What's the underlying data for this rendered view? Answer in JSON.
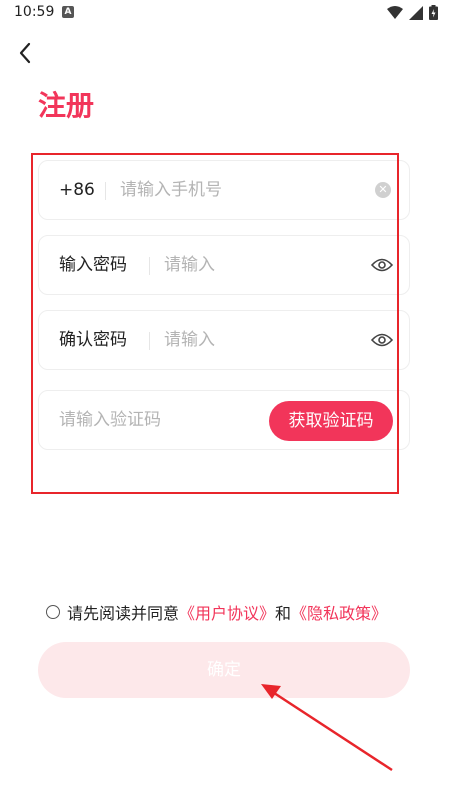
{
  "status_bar": {
    "time": "10:59",
    "notification_letter": "A"
  },
  "header": {
    "title": "注册"
  },
  "form": {
    "phone": {
      "prefix": "+86",
      "placeholder": "请输入手机号"
    },
    "password": {
      "label": "输入密码",
      "placeholder": "请输入"
    },
    "confirm_password": {
      "label": "确认密码",
      "placeholder": "请输入"
    },
    "verification": {
      "placeholder": "请输入验证码",
      "button_label": "获取验证码"
    }
  },
  "agreement": {
    "prefix": "请先阅读并同意",
    "user_agreement": "《用户协议》",
    "conjunction": "和",
    "privacy_policy": "《隐私政策》"
  },
  "confirm_button": {
    "label": "确定"
  },
  "colors": {
    "accent": "#f2355a",
    "confirm_disabled_bg": "#fde8ea",
    "highlight_box": "#e8252b",
    "annotation_arrow": "#e8252b"
  }
}
